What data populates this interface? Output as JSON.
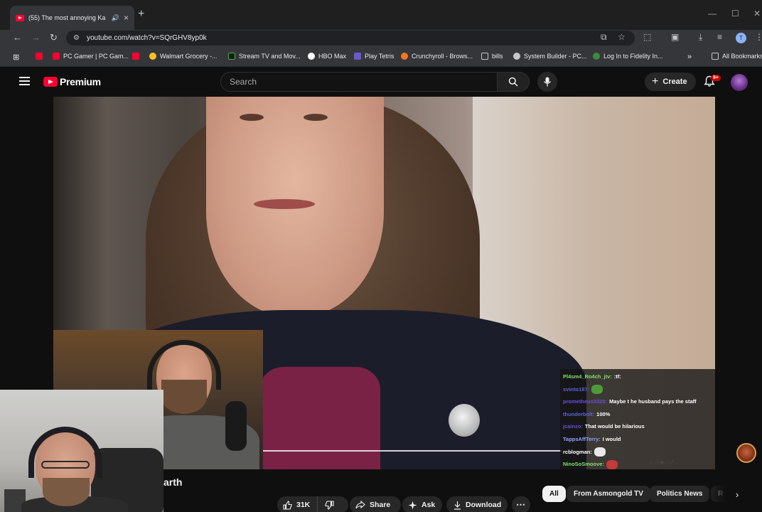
{
  "browser": {
    "tab": {
      "title": "(55) The most annoying Ka",
      "audio_icon": "speaker-icon",
      "close_icon": "close-icon"
    },
    "new_tab_icon": "plus-icon",
    "url": "youtube.com/watch?v=SQrGHV8yp0k",
    "profile_initial": "T",
    "bookmarks": [
      {
        "label": "PC Gamer | PC Gam...",
        "color": "#ff0033"
      },
      {
        "label": "Walmart Grocery -...",
        "color": "#ffc220"
      },
      {
        "label": "Stream TV and Mov...",
        "color": "#1b1b1b"
      },
      {
        "label": "HBO Max",
        "color": "#ffffff"
      },
      {
        "label": "Play Tetris",
        "color": "#6a5acd"
      },
      {
        "label": "Crunchyroll - Brows...",
        "color": "#f47521"
      },
      {
        "label": "bills",
        "color": "#c4c7c5"
      },
      {
        "label": "System Builder - PC...",
        "color": "#c4c7c5"
      },
      {
        "label": "Log In to Fidelity In...",
        "color": "#3c8b3c"
      }
    ],
    "all_bookmarks": "All Bookmarks"
  },
  "youtube": {
    "logo_text": "Premium",
    "search_placeholder": "Search",
    "create_label": "Create",
    "notifications_badge": "9+",
    "video_title_fragment": "arth",
    "like_count": "31K",
    "share_label": "Share",
    "ask_label": "Ask",
    "download_label": "Download",
    "chips": [
      "All",
      "From Asmongold TV",
      "Politics News",
      "R"
    ]
  },
  "chat": {
    "messages": [
      {
        "user": "Pl4sm4_Ro4ch_jtv:",
        "text": ":tf:",
        "color": "#7ee06d"
      },
      {
        "user": "svinto187:",
        "text": "",
        "emote": "#4e9a3a",
        "color": "#5a63d6"
      },
      {
        "user": "prometheus3320:",
        "text": "Maybe t he husband pays the staff",
        "color": "#6d4ed6"
      },
      {
        "user": "thunderbolt:",
        "text": "100%",
        "color": "#5a63d6"
      },
      {
        "user": "jcainzo:",
        "text": "That would be hilarious",
        "color": "#6d4ed6"
      },
      {
        "user": "TappsAffTerry:",
        "text": "I would",
        "color": "#8fa3ff"
      },
      {
        "user": "rcblogman:",
        "text": "",
        "emote": "#e8e8e8",
        "color": "#ffffff"
      },
      {
        "user": "NinoSoSmoove:",
        "text": "",
        "emote": "#c23a3a",
        "color": "#7ee06d"
      }
    ]
  },
  "colors": {
    "yt_red": "#ff0033",
    "bg": "#0f0f0f",
    "pill": "#272727"
  }
}
